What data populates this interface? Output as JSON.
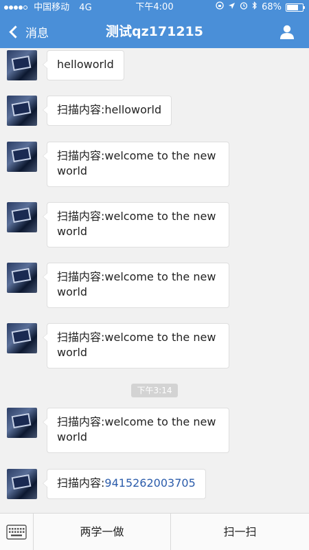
{
  "status_bar": {
    "carrier": "中国移动",
    "network": "4G",
    "time": "下午4:00",
    "battery": "68%",
    "battery_level": 0.68
  },
  "nav": {
    "back_label": "消息",
    "title": "测试qz171215"
  },
  "messages": [
    {
      "text": "helloworld"
    },
    {
      "text": "扫描内容:helloworld"
    },
    {
      "line1": "扫描内容:welcome to the new",
      "line2": "world"
    },
    {
      "line1": "扫描内容:welcome to the new",
      "line2": "world"
    },
    {
      "line1": "扫描内容:welcome to the new",
      "line2": "world"
    },
    {
      "line1": "扫描内容:welcome to the new",
      "line2": "world"
    },
    {
      "line1": "扫描内容:welcome to the new",
      "line2": "world"
    },
    {
      "prefix": "扫描内容:",
      "link": "9415262003705"
    }
  ],
  "timestamp": "下午3:14",
  "bottom_bar": {
    "btn1": "两学一做",
    "btn2": "扫一扫"
  },
  "colors": {
    "nav_bg": "#4a8fd8",
    "link": "#2b5cab"
  }
}
